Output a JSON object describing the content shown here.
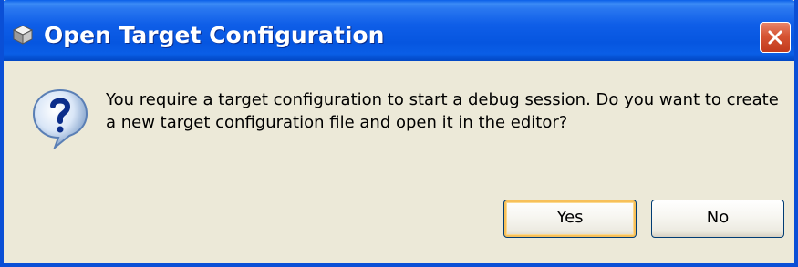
{
  "window": {
    "title": "Open Target Configuration",
    "title_icon": "cube-icon",
    "close_icon": "close-icon",
    "colors": {
      "titlebar": "#0a5ee6",
      "body": "#ece9d8",
      "close_button": "#d65433",
      "default_button_highlight": "#f7c05a"
    }
  },
  "dialog": {
    "icon": "question-icon",
    "message": "You require a target configuration to start a debug session. Do you want to create a new target configuration file and open it in the editor?",
    "buttons": {
      "yes_label": "Yes",
      "no_label": "No"
    }
  }
}
